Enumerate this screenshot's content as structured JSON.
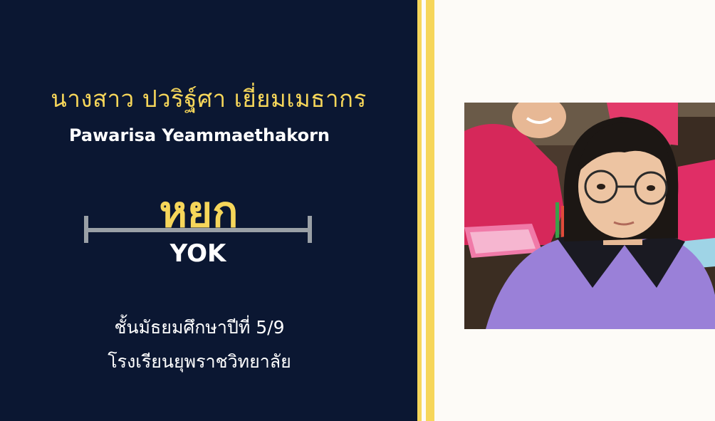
{
  "profile": {
    "name_thai": "นางสาว ปวริฐ์ศา เยี่ยมเมธากร",
    "name_english": "Pawarisa Yeammaethakorn",
    "nickname_thai": "หยก",
    "nickname_english": "YOK",
    "grade": "ชั้นมัธยมศึกษาปีที่ 5/9",
    "school": "โรงเรียนยุพราชวิทยาลัย"
  },
  "colors": {
    "panel_background": "#0b1732",
    "accent_yellow": "#f6d65a",
    "page_background": "#fdfbf7"
  }
}
